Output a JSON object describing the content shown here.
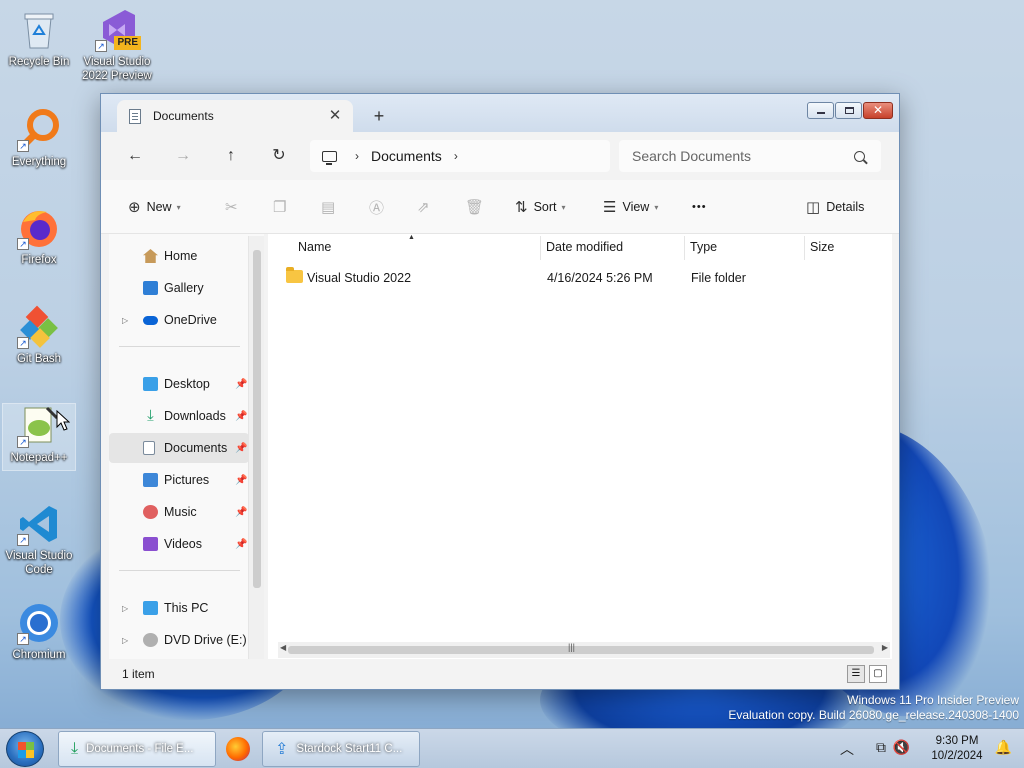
{
  "desktop": {
    "icons": [
      {
        "label": "Recycle Bin"
      },
      {
        "label": "Visual Studio 2022 Preview",
        "badge": "PRE"
      },
      {
        "label": "Everything"
      },
      {
        "label": "Firefox"
      },
      {
        "label": "Git Bash"
      },
      {
        "label": "Notepad++"
      },
      {
        "label": "Visual Studio Code"
      },
      {
        "label": "Chromium"
      }
    ],
    "watermark": {
      "line1": "Windows 11 Pro Insider Preview",
      "line2": "Evaluation copy. Build 26080.ge_release.240308-1400"
    }
  },
  "window": {
    "tab": {
      "title": "Documents",
      "close": "✕"
    },
    "new_tab": "+",
    "nav": {
      "back": "←",
      "forward": "→",
      "up": "↑",
      "refresh": "↻"
    },
    "address": {
      "crumbs": [
        "Documents"
      ],
      "sep": "›"
    },
    "search": {
      "placeholder": "Search Documents"
    },
    "commands": {
      "new": "New",
      "sort": "Sort",
      "view": "View",
      "more": "•••",
      "details": "Details"
    },
    "nav_pane": {
      "top": [
        {
          "label": "Home",
          "color": "#8a6a3c"
        },
        {
          "label": "Gallery",
          "color": "#2f7fd6"
        },
        {
          "label": "OneDrive",
          "color": "#0a64d6"
        }
      ],
      "quick": [
        {
          "label": "Desktop",
          "color": "#3aa0e8"
        },
        {
          "label": "Downloads",
          "color": "#1f9e6a"
        },
        {
          "label": "Documents",
          "color": "#7b8b9c"
        },
        {
          "label": "Pictures",
          "color": "#3d87d8"
        },
        {
          "label": "Music",
          "color": "#e06060"
        },
        {
          "label": "Videos",
          "color": "#8a4fd0"
        }
      ],
      "bottom": [
        {
          "label": "This PC",
          "color": "#3aa0e8"
        },
        {
          "label": "DVD Drive (E:) W",
          "color": "#888888"
        }
      ]
    },
    "columns": [
      "Name",
      "Date modified",
      "Type",
      "Size"
    ],
    "rows": [
      {
        "name": "Visual Studio 2022",
        "date": "4/16/2024 5:26 PM",
        "type": "File folder",
        "size": ""
      }
    ],
    "status": "1 item"
  },
  "taskbar": {
    "buttons": [
      {
        "label": "Documents - File E..."
      },
      {
        "label": "Stardock Start11 C..."
      }
    ],
    "clock": {
      "time": "9:30 PM",
      "date": "10/2/2024"
    }
  }
}
